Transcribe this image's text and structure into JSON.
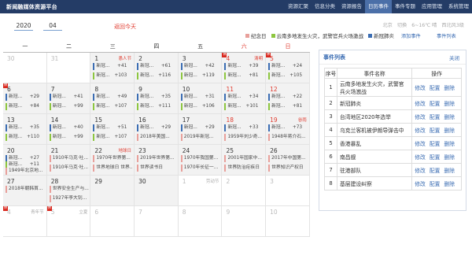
{
  "app_title": "新闻融媒体资源平台",
  "nav": [
    "资源汇聚",
    "信息分类",
    "资源报告",
    "日历事件",
    "事件专题",
    "应用管理",
    "系统管理"
  ],
  "nav_active": 3,
  "controls": {
    "year": "2020",
    "month": "04",
    "back_today": "返回今天"
  },
  "weather": [
    "北京",
    "切换",
    "6~16℃ 晴",
    "西北风3级"
  ],
  "legend": [
    {
      "label": "纪念日",
      "color": "#e8a09b"
    },
    {
      "label": "云南多地发生火灾，武警官兵火场激战",
      "color": "#8dc63f"
    },
    {
      "label": "新冠肺炎",
      "color": "#3b6db3"
    }
  ],
  "add_event": "添加事件",
  "event_list_link": "事件列表",
  "weekdays": [
    "一",
    "二",
    "三",
    "四",
    "五",
    "六",
    "日"
  ],
  "weeks": [
    [
      {
        "day": "30",
        "other": true
      },
      {
        "day": "31",
        "other": true
      },
      {
        "day": "1",
        "label": "愚人节",
        "events": [
          {
            "text": "新冠...",
            "count": "+41",
            "color": "#3b6db3"
          },
          {
            "text": "新冠...",
            "count": "+103",
            "color": "#8dc63f"
          }
        ]
      },
      {
        "day": "2",
        "events": [
          {
            "text": "新冠...",
            "count": "+61",
            "color": "#3b6db3"
          },
          {
            "text": "新冠...",
            "count": "+116",
            "color": "#8dc63f"
          }
        ]
      },
      {
        "day": "3",
        "events": [
          {
            "text": "新冠...",
            "count": "+42",
            "color": "#3b6db3"
          },
          {
            "text": "新冠...",
            "count": "+119",
            "color": "#8dc63f"
          }
        ]
      },
      {
        "day": "4",
        "label": "清明",
        "red": true,
        "tag": true,
        "events": [
          {
            "text": "新冠...",
            "count": "+39",
            "color": "#3b6db3"
          },
          {
            "text": "新冠...",
            "count": "+81",
            "color": "#8dc63f"
          }
        ]
      },
      {
        "day": "5",
        "red": true,
        "tag": true,
        "events": [
          {
            "text": "新冠...",
            "count": "+24",
            "color": "#3b6db3"
          },
          {
            "text": "新冠...",
            "count": "+105",
            "color": "#8dc63f"
          }
        ]
      }
    ],
    [
      {
        "day": "6",
        "tag": true,
        "events": [
          {
            "text": "新冠...",
            "count": "+29",
            "color": "#3b6db3"
          },
          {
            "text": "新冠...",
            "count": "+84",
            "color": "#8dc63f"
          }
        ]
      },
      {
        "day": "7",
        "events": [
          {
            "text": "新冠...",
            "count": "+41",
            "color": "#3b6db3"
          },
          {
            "text": "新冠...",
            "count": "+99",
            "color": "#8dc63f"
          }
        ]
      },
      {
        "day": "8",
        "events": [
          {
            "text": "新冠...",
            "count": "+49",
            "color": "#3b6db3"
          },
          {
            "text": "新冠...",
            "count": "+107",
            "color": "#8dc63f"
          }
        ]
      },
      {
        "day": "9",
        "events": [
          {
            "text": "新冠...",
            "count": "+35",
            "color": "#3b6db3"
          },
          {
            "text": "新冠...",
            "count": "+111",
            "color": "#8dc63f"
          }
        ]
      },
      {
        "day": "10",
        "events": [
          {
            "text": "新冠...",
            "count": "+31",
            "color": "#3b6db3"
          },
          {
            "text": "新冠...",
            "count": "+106",
            "color": "#8dc63f"
          }
        ]
      },
      {
        "day": "11",
        "red": true,
        "events": [
          {
            "text": "新冠...",
            "count": "+34",
            "color": "#3b6db3"
          },
          {
            "text": "新冠...",
            "count": "+101",
            "color": "#8dc63f"
          }
        ]
      },
      {
        "day": "12",
        "red": true,
        "events": [
          {
            "text": "新冠...",
            "count": "+22",
            "color": "#3b6db3"
          },
          {
            "text": "新冠...",
            "count": "+81",
            "color": "#8dc63f"
          }
        ]
      }
    ],
    [
      {
        "day": "13",
        "events": [
          {
            "text": "新冠...",
            "count": "+35",
            "color": "#3b6db3"
          },
          {
            "text": "新冠...",
            "count": "+110",
            "color": "#8dc63f"
          }
        ]
      },
      {
        "day": "14",
        "events": [
          {
            "text": "新冠...",
            "count": "+40",
            "color": "#3b6db3"
          },
          {
            "text": "新冠...",
            "count": "+99",
            "color": "#8dc63f"
          }
        ]
      },
      {
        "day": "15",
        "events": [
          {
            "text": "新冠...",
            "count": "+51",
            "color": "#3b6db3"
          },
          {
            "text": "新冠...",
            "count": "+107",
            "color": "#8dc63f"
          }
        ]
      },
      {
        "day": "16",
        "events": [
          {
            "text": "新冠...",
            "count": "+29",
            "color": "#3b6db3"
          },
          {
            "text": "2018年美国...",
            "count": "",
            "color": "#e8a09b"
          }
        ]
      },
      {
        "day": "17",
        "events": [
          {
            "text": "新冠...",
            "count": "+29",
            "color": "#3b6db3"
          },
          {
            "text": "2019年新冠...",
            "count": "",
            "color": "#e8a09b"
          }
        ]
      },
      {
        "day": "18",
        "red": true,
        "events": [
          {
            "text": "新冠...",
            "count": "+33",
            "color": "#3b6db3"
          },
          {
            "text": "1959年刘少奇...",
            "count": "",
            "color": "#e8a09b"
          }
        ]
      },
      {
        "day": "19",
        "label": "谷雨",
        "red": true,
        "events": [
          {
            "text": "新冠...",
            "count": "+73",
            "color": "#3b6db3"
          },
          {
            "text": "1948年蒋介石...",
            "count": "",
            "color": "#e8a09b"
          }
        ]
      }
    ],
    [
      {
        "day": "20",
        "events": [
          {
            "text": "新冠...",
            "count": "+27",
            "color": "#3b6db3"
          },
          {
            "text": "新冠...",
            "count": "+11",
            "color": "#8dc63f"
          },
          {
            "text": "1949年北京地...",
            "count": "",
            "color": "#e8a09b"
          }
        ]
      },
      {
        "day": "21",
        "events": [
          {
            "text": "1910年马克·吐...",
            "count": "",
            "color": "#e8a09b"
          },
          {
            "text": "1910年马克·吐...",
            "count": "",
            "color": "#e8a09b"
          }
        ]
      },
      {
        "day": "22",
        "label": "地球日",
        "events": [
          {
            "text": "1970年世界第...",
            "count": "",
            "color": "#e8a09b"
          },
          {
            "text": "世界地球日 世界...",
            "count": "",
            "color": "#e8a09b"
          }
        ]
      },
      {
        "day": "23",
        "events": [
          {
            "text": "2019年世界第...",
            "count": "",
            "color": "#e8a09b"
          },
          {
            "text": "世界读书日",
            "count": "",
            "color": "#e8a09b"
          }
        ]
      },
      {
        "day": "24",
        "events": [
          {
            "text": "1970年我国第...",
            "count": "",
            "color": "#e8a09b"
          },
          {
            "text": "1970年长征一...",
            "count": "",
            "color": "#e8a09b"
          }
        ]
      },
      {
        "day": "25",
        "events": [
          {
            "text": "2001年国家中...",
            "count": "",
            "color": "#e8a09b"
          },
          {
            "text": "世界防治疟疾日",
            "count": "",
            "color": "#e8a09b"
          }
        ]
      },
      {
        "day": "26",
        "events": [
          {
            "text": "2017年中国第...",
            "count": "",
            "color": "#e8a09b"
          },
          {
            "text": "世界知识产权日",
            "count": "",
            "color": "#e8a09b"
          }
        ]
      }
    ],
    [
      {
        "day": "27",
        "events": [
          {
            "text": "2018年朝韩首...",
            "count": "",
            "color": "#e8a09b"
          }
        ]
      },
      {
        "day": "28",
        "events": [
          {
            "text": "世界安全生产与...",
            "count": "",
            "color": "#e8a09b"
          },
          {
            "text": "1927年李大钊...",
            "count": "",
            "color": "#e8a09b"
          }
        ]
      },
      {
        "day": "29"
      },
      {
        "day": "30"
      },
      {
        "day": "1",
        "other": true,
        "label": "劳动节",
        "grey": true
      },
      {
        "day": "2",
        "other": true
      },
      {
        "day": "3",
        "other": true
      }
    ],
    [
      {
        "day": "4",
        "other": true,
        "label": "青年节",
        "grey": true,
        "tag": true
      },
      {
        "day": "5",
        "other": true,
        "label": "立夏",
        "grey": true,
        "tag": true
      },
      {
        "day": "6",
        "other": true
      },
      {
        "day": "7",
        "other": true
      },
      {
        "day": "8",
        "other": true
      },
      {
        "day": "9",
        "other": true
      },
      {
        "day": "10",
        "other": true
      }
    ]
  ],
  "panel": {
    "title": "事件列表",
    "close": "关闭",
    "headers": [
      "序号",
      "事件名称",
      "操作"
    ],
    "actions": [
      "修改",
      "配置",
      "删除"
    ],
    "rows": [
      {
        "num": "1",
        "name": "云南多地发生火灾，武警官兵火场激战"
      },
      {
        "num": "2",
        "name": "新冠肺炎"
      },
      {
        "num": "3",
        "name": "台湾地区2020年选举"
      },
      {
        "num": "4",
        "name": "乌克兰客机被伊朗导弹击中"
      },
      {
        "num": "5",
        "name": "香港暴乱"
      },
      {
        "num": "6",
        "name": "南昌舰"
      },
      {
        "num": "7",
        "name": "驻港部队"
      },
      {
        "num": "8",
        "name": "基层建设纠察"
      }
    ]
  }
}
